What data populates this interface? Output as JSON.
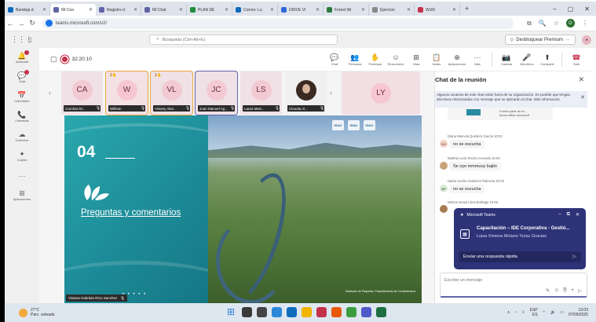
{
  "browser": {
    "tabs": [
      {
        "label": "Bandeja d",
        "color": "#0f6cbd"
      },
      {
        "label": "IM Coo",
        "color": "#6264a7",
        "active": true
      },
      {
        "label": "Registro d",
        "color": "#6264a7"
      },
      {
        "label": "IM Chat",
        "color": "#6264a7"
      },
      {
        "label": "PLAN DE",
        "color": "#1e8e3e"
      },
      {
        "label": "Correo: Lu",
        "color": "#0f6cbd"
      },
      {
        "label": "DRIVE VI",
        "color": "#3367d6"
      },
      {
        "label": "Forest Wi",
        "color": "#2d7a3a"
      },
      {
        "label": "Ejercicio",
        "color": "#888888"
      },
      {
        "label": "WUR",
        "color": "#c4314b"
      }
    ],
    "new_tab": "+",
    "url": "teams.microsoft.com/v2/"
  },
  "teams": {
    "search_placeholder": "Búsqueda (Ctrl+Alt+E)",
    "unblock_label": "Desbloquear Premium",
    "more": "···",
    "rail": [
      {
        "label": "Actividad",
        "icon": "bell-icon",
        "glyph": "🔔",
        "dot": true
      },
      {
        "label": "Chat",
        "icon": "chat-icon",
        "glyph": "💬",
        "dot": true
      },
      {
        "label": "Calendario",
        "icon": "calendar-icon",
        "glyph": "📅"
      },
      {
        "label": "Llamadas",
        "icon": "phone-icon",
        "glyph": "📞"
      },
      {
        "label": "OneDrive",
        "icon": "cloud-icon",
        "glyph": "☁"
      },
      {
        "label": "Copilot",
        "icon": "copilot-icon",
        "glyph": "✦"
      },
      {
        "label": "",
        "icon": "more-icon",
        "glyph": "···"
      },
      {
        "label": "Aplicaciones",
        "icon": "apps-icon",
        "glyph": "⊞"
      }
    ]
  },
  "meeting": {
    "timer": "32:20:10",
    "tools": [
      {
        "label": "Chat",
        "icon": "chat-icon",
        "glyph": "💬"
      },
      {
        "label": "Personas",
        "icon": "people-icon",
        "glyph": "👥"
      },
      {
        "label": "Participar",
        "icon": "raise-hand-icon",
        "glyph": "✋"
      },
      {
        "label": "Reacciones",
        "icon": "reactions-icon",
        "glyph": "☺"
      },
      {
        "label": "Vista",
        "icon": "view-icon",
        "glyph": "⊞"
      },
      {
        "label": "Notas",
        "icon": "notes-icon",
        "glyph": "📋"
      },
      {
        "label": "Aplicaciones",
        "icon": "add-app-icon",
        "glyph": "⊕"
      },
      {
        "label": "Más",
        "icon": "more-icon",
        "glyph": "···"
      },
      {
        "label": "Cámara",
        "icon": "camera-off-icon",
        "glyph": "📷"
      },
      {
        "label": "Micrófono",
        "icon": "mic-off-icon",
        "glyph": "🎤"
      },
      {
        "label": "Compartir",
        "icon": "share-icon",
        "glyph": "⬆"
      },
      {
        "label": "Salir",
        "icon": "leave-icon",
        "glyph": "☎"
      }
    ],
    "participants": [
      {
        "initials": "CA",
        "name": "Carolina M...",
        "bg": "#efe1e5",
        "avatar": "#f3c9d3",
        "style": ""
      },
      {
        "initials": "W",
        "name": "William",
        "bg": "#f3e1e6",
        "avatar": "#f6c7d2",
        "style": "hl",
        "hand": "2"
      },
      {
        "initials": "VL",
        "name": "Viviany Alex...",
        "bg": "#efe1e5",
        "avatar": "#f3c9d3",
        "style": "hl",
        "hand": "1"
      },
      {
        "initials": "JC",
        "name": "Juan Manuel Ag...",
        "bg": "#efe1e5",
        "avatar": "#f3c9d3",
        "style": "sel"
      },
      {
        "initials": "LS",
        "name": "Laura Mert...",
        "bg": "#efe1e5",
        "avatar": "#f3c9d3",
        "style": ""
      },
      {
        "initials": "",
        "name": "Claudia Al...",
        "bg": "#f0f0f0",
        "avatar": "",
        "style": "",
        "photo": true
      }
    ],
    "big_tile": "LY",
    "slide": {
      "number": "04",
      "title": "Preguntas y comentarios",
      "presenter": "Viviana Gabriela Ríos Sanchez",
      "logos": [
        "IGAC",
        "IGAC",
        "IGAC"
      ],
      "photo_credit": "Santuario de Paquelas / Departamento de Cundinamarca",
      "dots": "• • • • •"
    }
  },
  "chat": {
    "title": "Chat de la reunión",
    "notice": "Algunos usuarios de este chat están fuera de su organización. Es posible que tengan directivas relacionadas con mensaje que se aplicarán al chat. Más información",
    "card_text": "Forma parte de la... forms.office.microsoft",
    "messages": [
      {
        "author": "Diana Marcela Quintero García  10:03",
        "initials": "DG",
        "text": "no se escucha",
        "color": "#f8d2c4"
      },
      {
        "author": "Martha Lucía Rocha Acevedo  10:03",
        "initials": "",
        "text": "Se oye mmmuuy bajito",
        "color": "#c9a37a"
      },
      {
        "author": "Nubia Cecilia Gutiérrez Palencia  10:03",
        "initials": "NP",
        "text": "no se escucha",
        "color": "#d7ecd5"
      },
      {
        "author": "Nelson Jesus Llera Buitrago  10:03",
        "initials": "",
        "text": "",
        "color": "#a67c52"
      }
    ],
    "toast": {
      "app": "Microsoft Teams",
      "title": "Capacitación – IDE Corporativa - Gestió...",
      "subtitle": "Luisa Ximena Molano Yurac Gracias",
      "reply": "Enviar una respuesta rápida"
    },
    "compose_placeholder": "Escribe un mensaje"
  },
  "taskbar": {
    "temp": "27°C",
    "weather": "Parc. soleado",
    "lang": "ESP",
    "lang2": "ES",
    "time": "13:03",
    "date": "07/05/2025",
    "apps": [
      "#2b7cd3",
      "#3a3a3a",
      "#444444",
      "#2b88d8",
      "#0f6cbd",
      "#f2b400",
      "#c4314b",
      "#e9590c",
      "#3a9e3f",
      "#5059c9",
      "#1d6f42"
    ]
  }
}
